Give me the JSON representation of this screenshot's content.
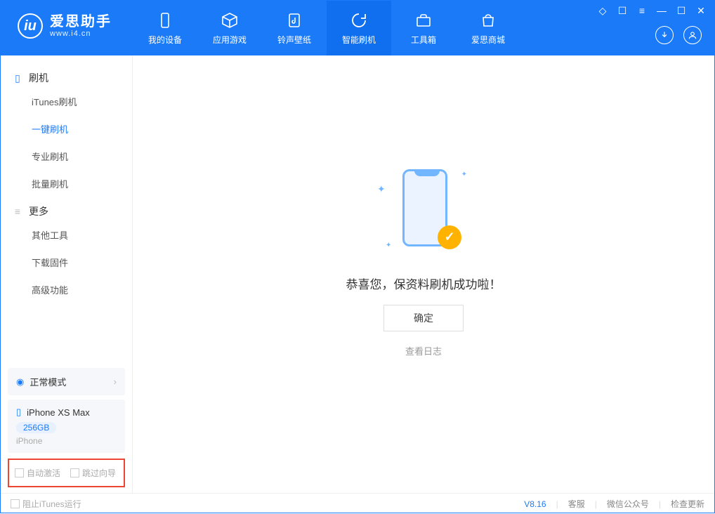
{
  "app": {
    "title": "爱思助手",
    "subtitle": "www.i4.cn"
  },
  "tabs": {
    "device": "我的设备",
    "apps": "应用游戏",
    "ring": "铃声壁纸",
    "flash": "智能刷机",
    "tools": "工具箱",
    "store": "爱思商城"
  },
  "sidebar": {
    "group1": "刷机",
    "items1": {
      "itunes": "iTunes刷机",
      "oneclick": "一键刷机",
      "pro": "专业刷机",
      "batch": "批量刷机"
    },
    "group2": "更多",
    "items2": {
      "other": "其他工具",
      "firmware": "下载固件",
      "advanced": "高级功能"
    }
  },
  "mode": {
    "label": "正常模式"
  },
  "device": {
    "name": "iPhone XS Max",
    "capacity": "256GB",
    "type": "iPhone"
  },
  "options": {
    "auto_activate": "自动激活",
    "skip_guide": "跳过向导"
  },
  "main": {
    "success": "恭喜您，保资料刷机成功啦！",
    "confirm": "确定",
    "view_log": "查看日志"
  },
  "footer": {
    "block_itunes": "阻止iTunes运行",
    "version": "V8.16",
    "support": "客服",
    "wechat": "微信公众号",
    "update": "检查更新"
  }
}
